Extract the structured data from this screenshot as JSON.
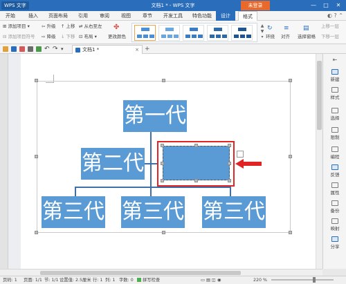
{
  "titlebar": {
    "logo_text": "WPS 文字",
    "title": "文档1 * - WPS 文字",
    "login": "未登录",
    "window_buttons": [
      "—",
      "□",
      "✕"
    ]
  },
  "menu": {
    "tabs": [
      "开始",
      "插入",
      "页面布局",
      "引用",
      "审阅",
      "视图",
      "章节",
      "开发工具",
      "特色功能",
      "设计",
      "格式"
    ]
  },
  "ribbon": {
    "add_item": "添加项目",
    "add_assistant": "添加项目符号",
    "upgrade": "升级",
    "downgrade": "降级",
    "move_up": "上移",
    "move_down": "下移",
    "right_to_left": "从右至左",
    "layout": "布局",
    "change_color": "更改颜色",
    "layout_ring": "环绕",
    "align": "对齐",
    "selection_pane": "选择窗格",
    "bring_forward": "上移一层",
    "send_backward": "下移一层"
  },
  "quickbar": {
    "doc_tab": "文档1 *",
    "close_glyph": "×",
    "new_tab_glyph": "+"
  },
  "diagram": {
    "gen1": "第一代",
    "gen2": "第二代",
    "gen3_left": "第三代",
    "gen3_mid": "第三代",
    "gen3_right": "第三代",
    "selected_node_text": "",
    "accent": "#5b9bd5",
    "selection_color": "#e02424"
  },
  "right_panel": {
    "items": [
      "新建",
      "样式",
      "选择",
      "限制",
      "编程",
      "反馈",
      "属性",
      "备份",
      "映射",
      "分享"
    ]
  },
  "statusbar": {
    "page": "页码: 1",
    "pages": "页面: 1/1",
    "section": "节: 1/1",
    "setting": "设置值: 2.5厘米",
    "row": "行: 1",
    "column": "列: 1",
    "words": "字数: 0",
    "spell": "拼写检查",
    "zoom": "220 %"
  },
  "colors": {
    "brand": "#2a6ebb",
    "node_fill": "#5b9bd5",
    "login": "#e8692a"
  }
}
